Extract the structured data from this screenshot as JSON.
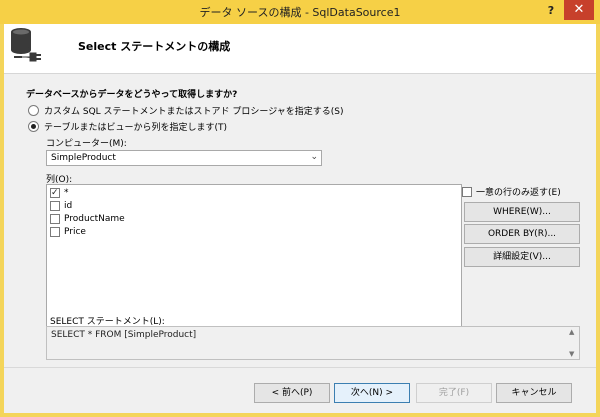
{
  "window": {
    "title": "データ ソースの構成 - SqlDataSource1",
    "help_glyph": "?",
    "close_glyph": "✕"
  },
  "header": {
    "title": "Select ステートメントの構成",
    "icon": "database-connect-icon"
  },
  "question": "データベースからデータをどうやって取得しますか?",
  "options": {
    "custom_sql": {
      "label": "カスタム SQL ステートメントまたはストアド プロシージャを指定する(S)",
      "selected": false
    },
    "table_view": {
      "label": "テーブルまたはビューから列を指定します(T)",
      "selected": true
    }
  },
  "name_label": "コンピューター(M):",
  "name_value": "SimpleProduct",
  "columns_label": "列(O):",
  "columns": [
    {
      "label": "*",
      "checked": true
    },
    {
      "label": "id",
      "checked": false
    },
    {
      "label": "ProductName",
      "checked": false
    },
    {
      "label": "Price",
      "checked": false
    }
  ],
  "distinct_label": "一意の行のみ返す(E)",
  "distinct_checked": false,
  "side_buttons": {
    "where": "WHERE(W)...",
    "order_by": "ORDER BY(R)...",
    "advanced": "詳細設定(V)..."
  },
  "sql_label": "SELECT ステートメント(L):",
  "sql_text": "SELECT * FROM [SimpleProduct]",
  "footer": {
    "prev": "< 前へ(P)",
    "next": "次へ(N) >",
    "finish": "完了(F)",
    "cancel": "キャンセル"
  },
  "colors": {
    "titlebar": "#f6d046",
    "close": "#c7402b"
  }
}
